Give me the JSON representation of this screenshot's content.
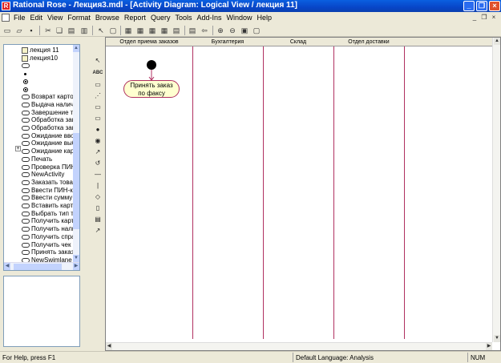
{
  "window": {
    "title": "Rational Rose - Лекция3.mdl - [Activity Diagram: Logical View / лекция 11]",
    "app_icon_glyph": "R"
  },
  "menu": {
    "items": [
      "File",
      "Edit",
      "View",
      "Format",
      "Browse",
      "Report",
      "Query",
      "Tools",
      "Add-Ins",
      "Window",
      "Help"
    ]
  },
  "browser": {
    "items": [
      {
        "label": "лекция 11",
        "icon": "diagram-icon"
      },
      {
        "label": "лекция10",
        "icon": "diagram-icon"
      },
      {
        "label": "",
        "icon": "state-icon"
      },
      {
        "label": "",
        "icon": "small-dot-icon"
      },
      {
        "label": "",
        "icon": "bullseye-icon"
      },
      {
        "label": "",
        "icon": "bullseye-icon"
      },
      {
        "label": "Возврат карточки",
        "icon": "state-icon"
      },
      {
        "label": "Выдача наличных",
        "icon": "state-icon"
      },
      {
        "label": "Завершение транзакции",
        "icon": "state-icon"
      },
      {
        "label": "Обработка запроса",
        "icon": "state-icon"
      },
      {
        "label": "Обработка запроса",
        "icon": "state-icon"
      },
      {
        "label": "Ожидание ввода",
        "icon": "state-icon"
      },
      {
        "label": "Ожидание выбора",
        "icon": "state-icon"
      },
      {
        "label": "Ожидание карточки",
        "icon": "state-icon"
      },
      {
        "label": "Печать",
        "icon": "state-icon"
      },
      {
        "label": "Проверка ПИН-кода",
        "icon": "state-icon"
      },
      {
        "label": "NewActivity",
        "icon": "state-icon"
      },
      {
        "label": "Заказать товар",
        "icon": "state-icon"
      },
      {
        "label": "Ввести ПИН-код",
        "icon": "state-icon"
      },
      {
        "label": "Ввести сумму",
        "icon": "state-icon"
      },
      {
        "label": "Вставить карточку",
        "icon": "state-icon"
      },
      {
        "label": "Выбрать тип транзакции",
        "icon": "state-icon"
      },
      {
        "label": "Получить карточку",
        "icon": "state-icon"
      },
      {
        "label": "Получить наличные",
        "icon": "state-icon"
      },
      {
        "label": "Получить справку",
        "icon": "state-icon"
      },
      {
        "label": "Получить чек",
        "icon": "state-icon"
      },
      {
        "label": "Принять заказ по факсу",
        "icon": "state-icon"
      },
      {
        "label": "NewSwimlane",
        "icon": "state-icon"
      }
    ]
  },
  "swimlanes": [
    "Отдел приема заказов",
    "Бухгалтерия",
    "Склад",
    "Отдел доставки"
  ],
  "activity": {
    "line1": "Принять заказ",
    "line2": "по факсу"
  },
  "statusbar": {
    "help": "For Help, press F1",
    "language": "Default Language: Analysis",
    "num": "NUM"
  },
  "colors": {
    "titlebar": "#0846c8",
    "swimlane_line": "#b03060",
    "activity_fill": "#ffffd0"
  }
}
